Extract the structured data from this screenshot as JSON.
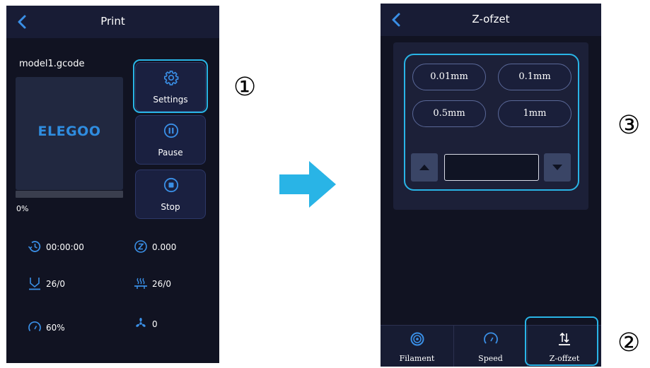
{
  "colors": {
    "screen_bg": "#111322",
    "topbar_bg": "#181c35",
    "button_bg": "#1a2040",
    "accent_blue": "#2f8de0",
    "highlight_cyan": "#29b4e6"
  },
  "print_screen": {
    "title": "Print",
    "file_name": "model1.gcode",
    "thumbnail_logo": "ELEGOO",
    "progress": {
      "value": 0,
      "label": "0%"
    },
    "buttons": {
      "settings": {
        "label": "Settings",
        "icon": "gear-icon"
      },
      "pause": {
        "label": "Pause",
        "icon": "pause-icon"
      },
      "stop": {
        "label": "Stop",
        "icon": "stop-icon"
      }
    },
    "stats": {
      "print_time": {
        "icon": "clock-icon",
        "value": "00:00:00"
      },
      "z_height": {
        "icon": "z-icon",
        "value": "0.000"
      },
      "nozzle_temp": {
        "icon": "nozzle-icon",
        "value": "26/0"
      },
      "bed_temp": {
        "icon": "heated-bed-icon",
        "value": "26/0"
      },
      "speed": {
        "icon": "gauge-icon",
        "value": "60%"
      },
      "fan": {
        "icon": "fan-icon",
        "value": "0"
      }
    }
  },
  "zoffset_screen": {
    "title": "Z-ofzet",
    "steps": [
      "0.01mm",
      "0.1mm",
      "0.5mm",
      "1mm"
    ],
    "input_value": "",
    "tabs": [
      {
        "label": "Filament",
        "icon": "filament-icon"
      },
      {
        "label": "Speed",
        "icon": "gauge-icon"
      },
      {
        "label": "Z-offzet",
        "icon": "z-offset-icon"
      }
    ]
  },
  "callouts": [
    "①",
    "②",
    "③"
  ]
}
